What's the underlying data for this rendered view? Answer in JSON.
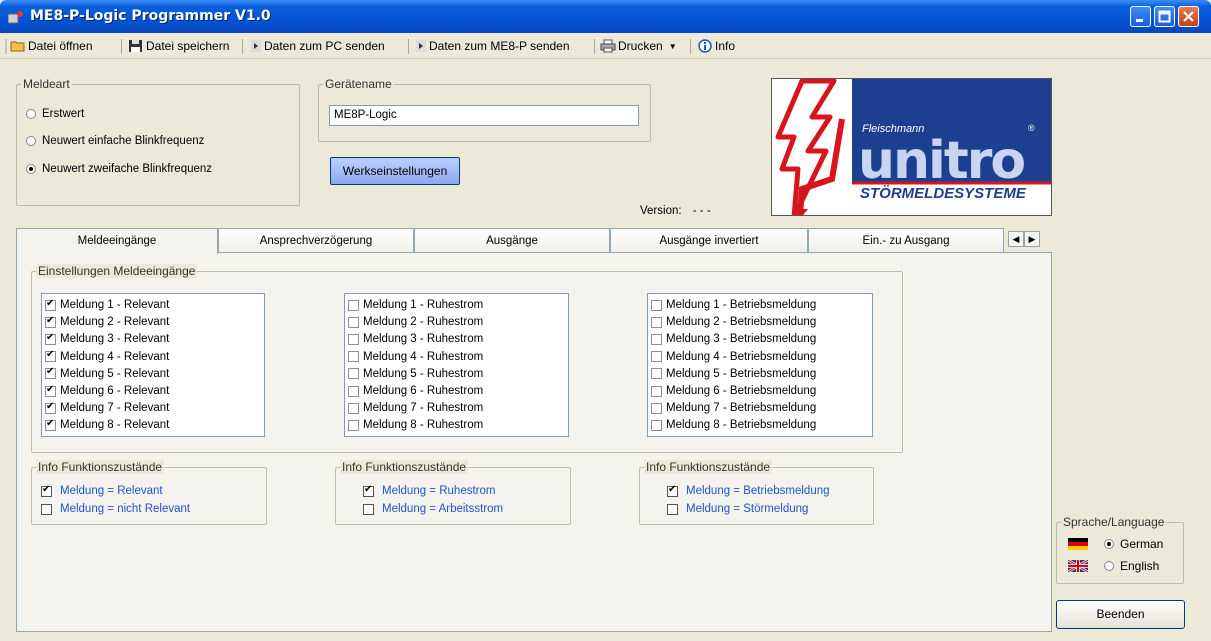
{
  "window": {
    "title": "ME8-P-Logic Programmer V1.0"
  },
  "toolbar": {
    "open": "Datei öffnen",
    "save": "Datei speichern",
    "send_pc": "Daten zum PC senden",
    "send_me8p": "Daten zum ME8-P senden",
    "print": "Drucken",
    "info": "Info"
  },
  "meldeart": {
    "legend": "Meldeart",
    "options": [
      "Erstwert",
      "Neuwert einfache Blinkfrequenz",
      "Neuwert zweifache Blinkfrequenz"
    ],
    "selected": "Neuwert zweifache Blinkfrequenz"
  },
  "geraetename": {
    "legend": "Gerätename",
    "value": "ME8P-Logic"
  },
  "factory_button": "Werkseinstellungen",
  "version": {
    "label": "Version:",
    "value": "- - -"
  },
  "logo": {
    "brand_small": "Fleischmann",
    "brand": "unitro",
    "tagline": "STÖRMELDESYSTEME",
    "registered": "®"
  },
  "tabs": [
    "Meldeeingänge",
    "Ansprechverzögerung",
    "Ausgänge",
    "Ausgänge invertiert",
    "Ein.- zu Ausgang"
  ],
  "active_tab": "Meldeeingänge",
  "settings": {
    "legend": "Einstellungen Meldeeingänge",
    "list1": [
      "Meldung 1 - Relevant",
      "Meldung 2 - Relevant",
      "Meldung 3 - Relevant",
      "Meldung 4 - Relevant",
      "Meldung 5 - Relevant",
      "Meldung 6 - Relevant",
      "Meldung 7 - Relevant",
      "Meldung 8 - Relevant"
    ],
    "list2": [
      "Meldung 1 - Ruhestrom",
      "Meldung 2 - Ruhestrom",
      "Meldung 3 - Ruhestrom",
      "Meldung 4 - Ruhestrom",
      "Meldung 5 - Ruhestrom",
      "Meldung 6 - Ruhestrom",
      "Meldung 7 - Ruhestrom",
      "Meldung 8 - Ruhestrom"
    ],
    "list3": [
      "Meldung 1 - Betriebsmeldung",
      "Meldung 2 - Betriebsmeldung",
      "Meldung 3 - Betriebsmeldung",
      "Meldung 4 - Betriebsmeldung",
      "Meldung 5 - Betriebsmeldung",
      "Meldung 6 - Betriebsmeldung",
      "Meldung 7 - Betriebsmeldung",
      "Meldung 8 - Betriebsmeldung"
    ],
    "list1_checked": [
      true,
      true,
      true,
      true,
      true,
      true,
      true,
      true
    ],
    "list2_checked": [
      false,
      false,
      false,
      false,
      false,
      false,
      false,
      false
    ],
    "list3_checked": [
      false,
      false,
      false,
      false,
      false,
      false,
      false,
      false
    ]
  },
  "info": [
    {
      "legend": "Info Funktionszustände",
      "on": "Meldung = Relevant",
      "off": "Meldung = nicht Relevant"
    },
    {
      "legend": "Info Funktionszustände",
      "on": "Meldung = Ruhestrom",
      "off": "Meldung = Arbeitsstrom"
    },
    {
      "legend": "Info Funktionszustände",
      "on": "Meldung = Betriebsmeldung",
      "off": "Meldung = Störmeldung"
    }
  ],
  "language": {
    "legend": "Sprache/Language",
    "german": "German",
    "english": "English",
    "selected": "German"
  },
  "exit_button": "Beenden",
  "colors": {
    "titlebar": "#0451d4",
    "info_text": "#1e55c8",
    "logo_red": "#d8141c",
    "logo_blue": "#1d3f8f"
  }
}
